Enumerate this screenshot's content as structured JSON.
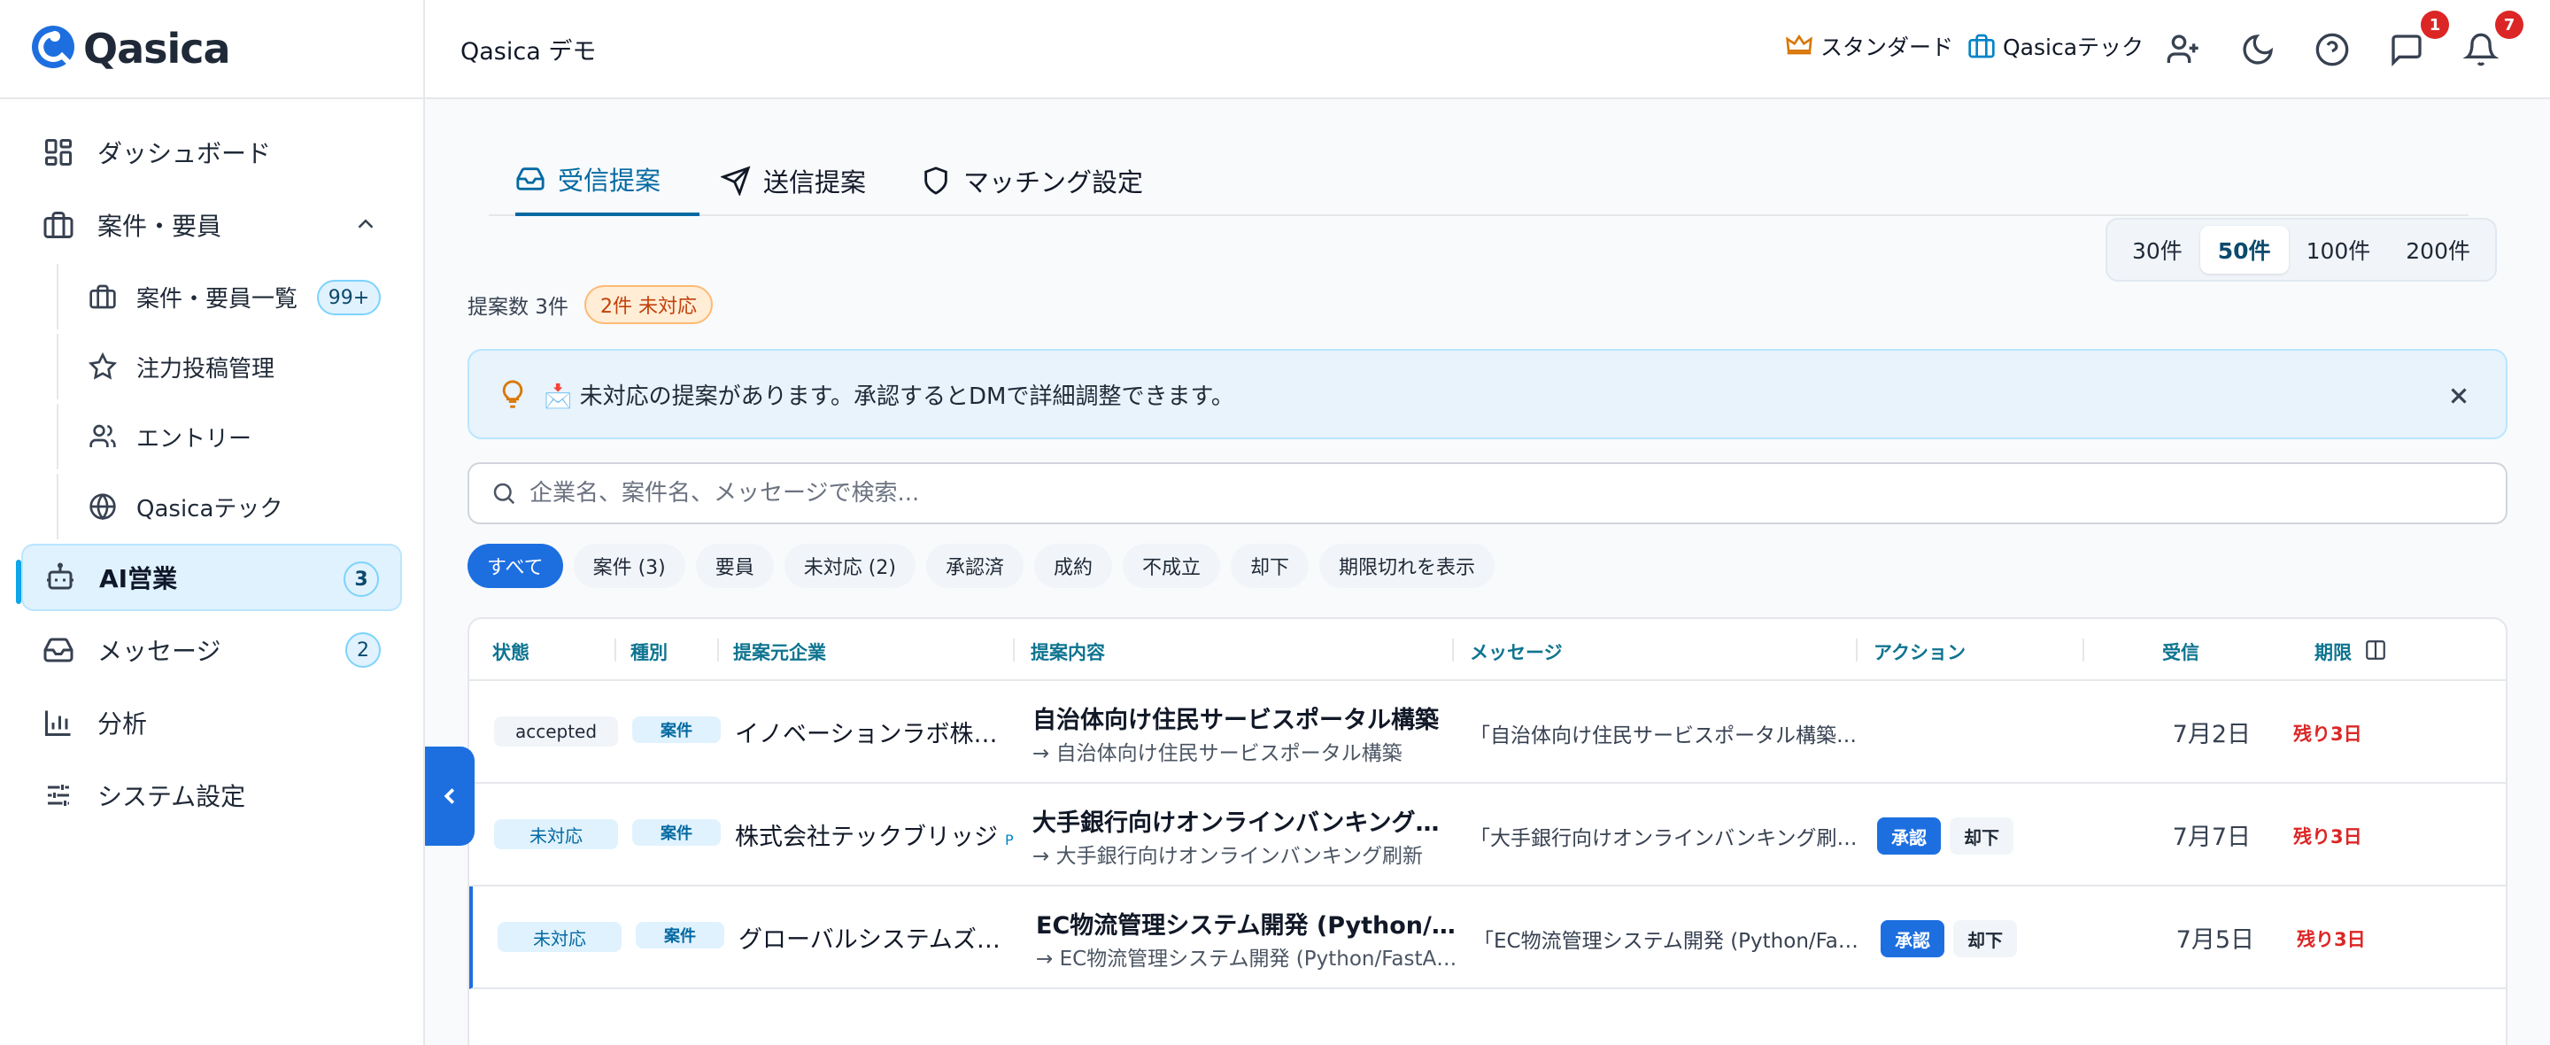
{
  "app": {
    "name": "Qasica",
    "workspace": "Qasica デモ"
  },
  "header": {
    "plan_label": "スタンダード",
    "company_label": "Qasicaテック",
    "message_badge": "1",
    "notification_badge": "7"
  },
  "sidebar": {
    "items": [
      {
        "label": "ダッシュボード",
        "icon": "dashboard-icon"
      },
      {
        "label": "案件・要員",
        "icon": "briefcase-icon"
      },
      {
        "label": "案件・要員一覧",
        "icon": "briefcase-icon",
        "badge": "99+"
      },
      {
        "label": "注力投稿管理",
        "icon": "star-icon"
      },
      {
        "label": "エントリー",
        "icon": "users-icon"
      },
      {
        "label": "Qasicaテック",
        "icon": "globe-icon"
      },
      {
        "label": "AI営業",
        "icon": "bot-icon",
        "badge": "3"
      },
      {
        "label": "メッセージ",
        "icon": "inbox-icon",
        "badge": "2"
      },
      {
        "label": "分析",
        "icon": "bar-chart-icon"
      },
      {
        "label": "システム設定",
        "icon": "sliders-icon"
      }
    ]
  },
  "tabs": [
    {
      "label": "受信提案",
      "icon": "inbox-icon"
    },
    {
      "label": "送信提案",
      "icon": "send-icon"
    },
    {
      "label": "マッチング設定",
      "icon": "shield-icon"
    }
  ],
  "page_sizes": [
    "30件",
    "50件",
    "100件",
    "200件"
  ],
  "selected_page_size": "50件",
  "summary": {
    "count": "提案数 3件",
    "pending": "2件 未対応"
  },
  "notice": {
    "text": "📩 未対応の提案があります。承認するとDMで詳細調整できます。"
  },
  "search": {
    "placeholder": "企業名、案件名、メッセージで検索..."
  },
  "filters": [
    "すべて",
    "案件 (3)",
    "要員",
    "未対応 (2)",
    "承認済",
    "成約",
    "不成立",
    "却下",
    "期限切れを表示"
  ],
  "table": {
    "columns": [
      "状態",
      "種別",
      "提案元企業",
      "提案内容",
      "メッセージ",
      "アクション",
      "受信",
      "期限"
    ],
    "rows": [
      {
        "status": "accepted",
        "kind": "案件",
        "company": "イノベーションラボ株式会社",
        "title": "自治体向け住民サービスポータル構築",
        "subtitle": "→ 自治体向け住民サービスポータル構築",
        "message": "「自治体向け住民サービスポータル構築」について",
        "received": "7月2日",
        "deadline": "残り3日"
      },
      {
        "status": "未対応",
        "kind": "案件",
        "company": "株式会社テックブリッジ",
        "company_mark": "P",
        "title": "大手銀行向けオンラインバンキング刷新",
        "subtitle": "→ 大手銀行向けオンラインバンキング刷新",
        "message": "「大手銀行向けオンラインバンキング刷新」について",
        "approve": "承認",
        "reject": "却下",
        "received": "7月7日",
        "deadline": "残り3日"
      },
      {
        "status": "未対応",
        "kind": "案件",
        "company": "グローバルシステムズ株式会社",
        "title": "EC物流管理システム開発 (Python/FastAPI)",
        "subtitle": "→ EC物流管理システム開発 (Python/FastAPI)",
        "message": "「EC物流管理システム開発 (Python/FastAPI)」について",
        "approve": "承認",
        "reject": "却下",
        "received": "7月5日",
        "deadline": "残り3日"
      }
    ]
  },
  "colors": {
    "accent": "#1d6fe0",
    "active_tab": "#0369a1",
    "danger": "#dc2626",
    "warning": "#c2410c"
  }
}
